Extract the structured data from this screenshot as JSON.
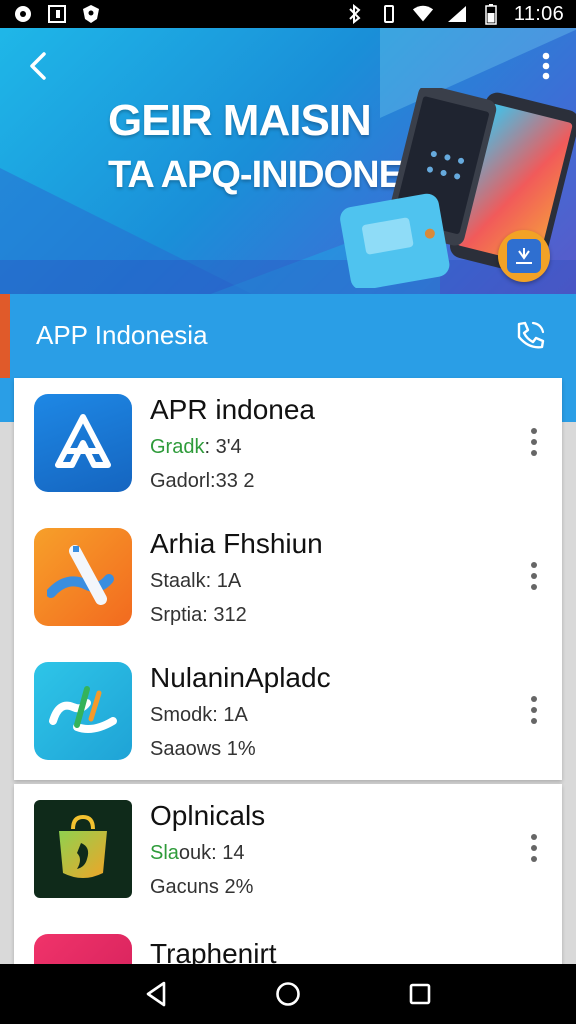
{
  "status_bar": {
    "time": "11:06",
    "left_icons": [
      "settings-icon",
      "screenshot-icon",
      "shield-icon"
    ],
    "right_icons": [
      "bluetooth-icon",
      "vibrate-icon",
      "wifi-icon",
      "signal-icon",
      "battery-icon"
    ]
  },
  "banner": {
    "title_line1": "GEIR MAISIN",
    "title_line2": "TA APQ-INIDONESIA"
  },
  "app_bar": {
    "title": "APP Indonesia"
  },
  "apps": [
    {
      "name": "APR indonea",
      "line1_green": "Gradk",
      "line1_rest": ": 3'4",
      "line2": "Gadorl:33 2",
      "icon": "app-logo-icon"
    },
    {
      "name": "Arhia Fhshiun",
      "line1": "Staalk: 1A",
      "line2": "Srptia: 312",
      "icon": "pen-icon"
    },
    {
      "name": "NulaninApladc",
      "line1": "Smodk: 1A",
      "line2": "Saaows 1%",
      "icon": "handshake-icon"
    },
    {
      "name": "Oplnicals",
      "line1_green": "Sla",
      "line1_rest": "ouk: 14",
      "line2": "Gacuns 2%",
      "icon": "shopping-bag-icon"
    },
    {
      "name": "Traphenirt"
    }
  ],
  "colors": {
    "status_bar": "#000000",
    "app_bar": "#2a9ee6",
    "accent_orange": "#f2a226",
    "green_text": "#2e9b3a"
  }
}
